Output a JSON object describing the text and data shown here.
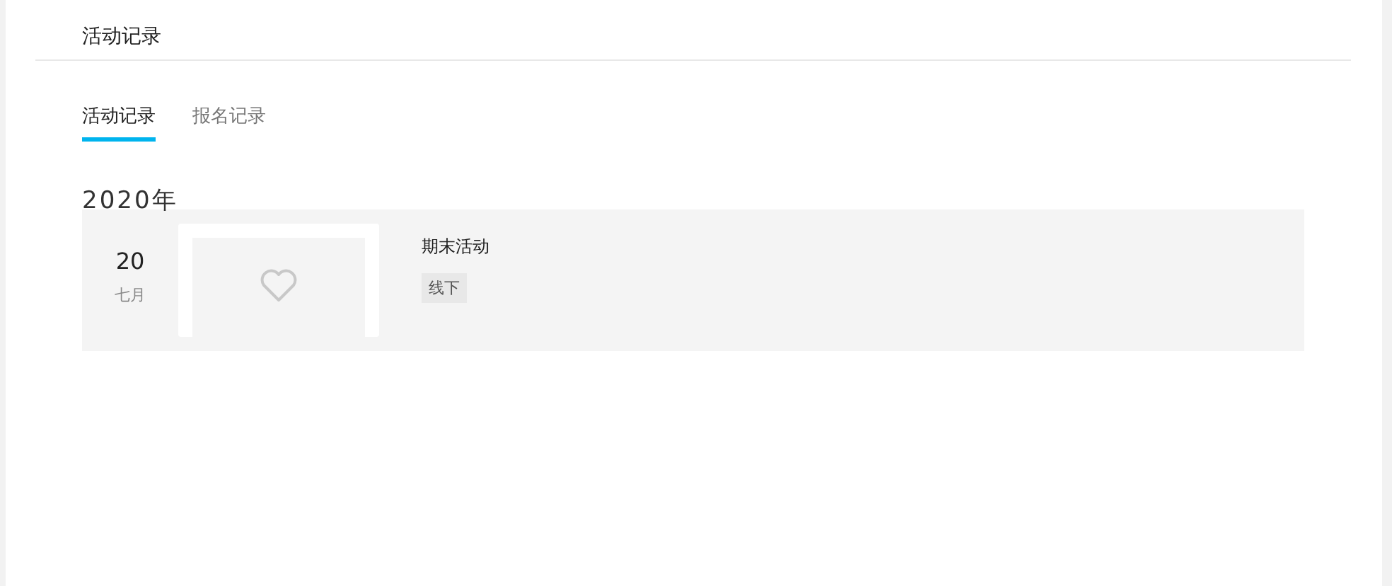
{
  "page_title": "活动记录",
  "tabs": [
    {
      "label": "活动记录",
      "selected": true
    },
    {
      "label": "报名记录",
      "selected": false
    }
  ],
  "year_groups": [
    {
      "year": "2020年",
      "activities": [
        {
          "day": "20",
          "month": "七月",
          "title": "期末活动",
          "tag": "线下"
        }
      ]
    }
  ]
}
